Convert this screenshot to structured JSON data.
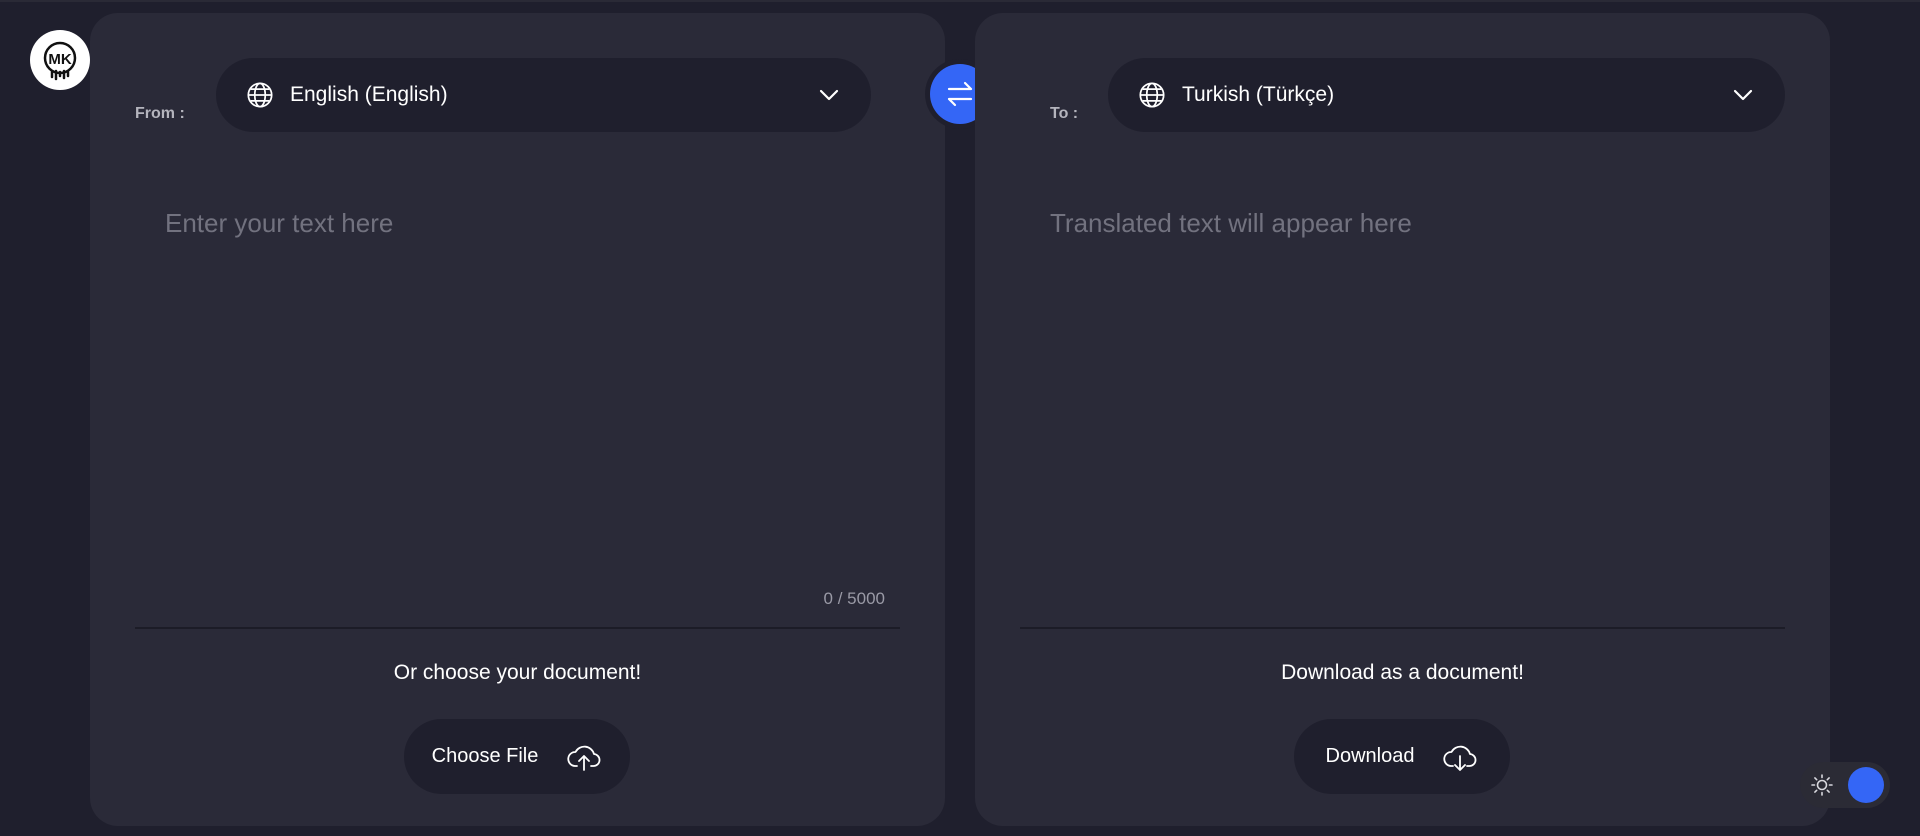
{
  "logo": {
    "text": "MK"
  },
  "source": {
    "label": "From :",
    "language": "English (English)",
    "placeholder": "Enter your text here",
    "counter": "0 / 5000",
    "doc_caption": "Or choose your document!",
    "button_label": "Choose File"
  },
  "target": {
    "label": "To :",
    "language": "Turkish (Türkçe)",
    "placeholder": "Translated text will appear here",
    "doc_caption": "Download as a document!",
    "button_label": "Download"
  },
  "colors": {
    "background": "#1f1f2d",
    "panel": "#2a2a38",
    "accent": "#3466f6"
  },
  "icons": {
    "language": "globe-icon",
    "dropdown": "chevron-down-icon",
    "swap": "swap-arrows-icon",
    "upload": "cloud-upload-icon",
    "download": "cloud-download-icon",
    "theme": "sun-icon"
  }
}
